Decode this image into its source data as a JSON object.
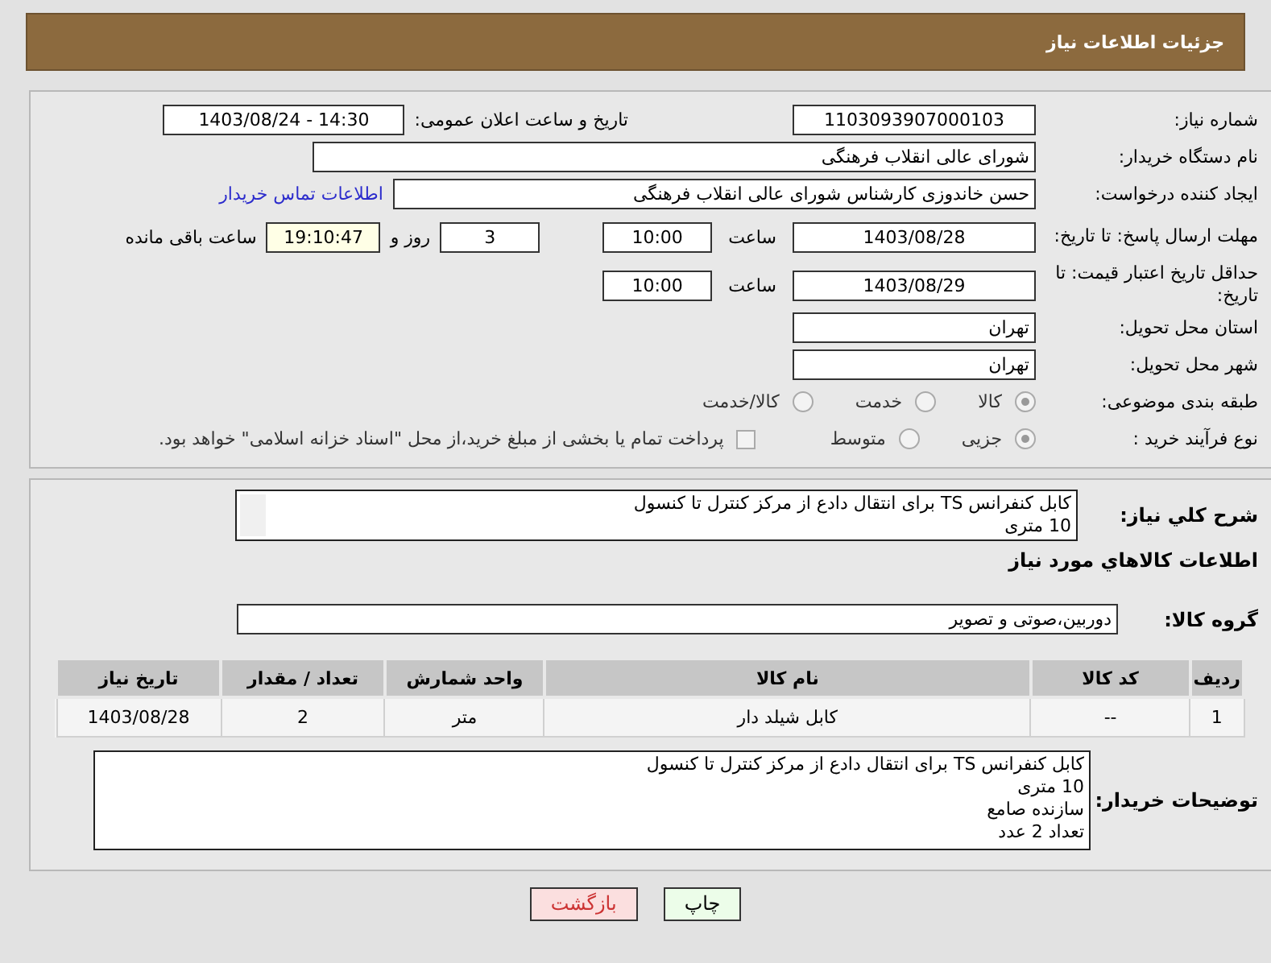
{
  "header": {
    "title": "جزئیات اطلاعات نیاز"
  },
  "need_number": {
    "label": "شماره نیاز:",
    "value": "1103093907000103"
  },
  "announce": {
    "label": "تاریخ و ساعت اعلان عمومی:",
    "value": "1403/08/24 - 14:30"
  },
  "buyer_org": {
    "label": "نام دستگاه خریدار:",
    "value": "شورای عالی انقلاب فرهنگی"
  },
  "requester": {
    "label": "ایجاد کننده درخواست:",
    "value": "حسن خاندوزی کارشناس شورای عالی انقلاب فرهنگی",
    "link": "اطلاعات تماس خریدار"
  },
  "reply_deadline": {
    "label": "مهلت ارسال پاسخ: تا تاریخ:",
    "date": "1403/08/28",
    "time_label": "ساعت",
    "time": "10:00",
    "days": "3",
    "days_label": "روز و",
    "remaining": "19:10:47",
    "remaining_label": "ساعت باقی مانده"
  },
  "price_validity": {
    "label": "حداقل تاریخ اعتبار قیمت: تا تاریخ:",
    "date": "1403/08/29",
    "time_label": "ساعت",
    "time": "10:00"
  },
  "province": {
    "label": "استان محل تحویل:",
    "value": "تهران"
  },
  "city": {
    "label": "شهر محل تحویل:",
    "value": "تهران"
  },
  "category": {
    "label": "طبقه بندی موضوعی:",
    "options": [
      {
        "label": "کالا",
        "selected": true
      },
      {
        "label": "خدمت",
        "selected": false
      },
      {
        "label": "کالا/خدمت",
        "selected": false
      }
    ]
  },
  "purchase_process": {
    "label": "نوع فرآیند خرید :",
    "options": [
      {
        "label": "جزیی",
        "selected": true
      },
      {
        "label": "متوسط",
        "selected": false
      }
    ],
    "treasury": {
      "checked": false,
      "text": "پرداخت تمام یا بخشی از مبلغ خرید،از محل \"اسناد خزانه اسلامی\" خواهد بود."
    }
  },
  "description": {
    "label": "شرح كلي نياز:",
    "lines": [
      "کابل کنفرانس TS برای انتقال دادع از مرکز کنترل تا کنسول",
      "10 متری"
    ]
  },
  "goods_title": "اطلاعات كالاهاي مورد نياز",
  "goods_group": {
    "label": "گروه کالا:",
    "value": "دوربین،صوتی و تصویر"
  },
  "table": {
    "columns": [
      "ردیف",
      "کد کالا",
      "نام کالا",
      "واحد شمارش",
      "تعداد / مقدار",
      "تاریخ نیاز"
    ],
    "rows": [
      [
        "1",
        "--",
        "کابل شیلد دار",
        "متر",
        "2",
        "1403/08/28"
      ]
    ]
  },
  "buyer_notes": {
    "label": "توضیحات خریدار:",
    "lines": [
      "کابل کنفرانس TS برای انتقال دادع از مرکز کنترل تا کنسول",
      "10 متری",
      "سازنده صامع",
      "تعداد 2 عدد"
    ]
  },
  "buttons": [
    {
      "label": "چاپ",
      "kind": "print"
    },
    {
      "label": "بازگشت",
      "kind": "back"
    }
  ]
}
